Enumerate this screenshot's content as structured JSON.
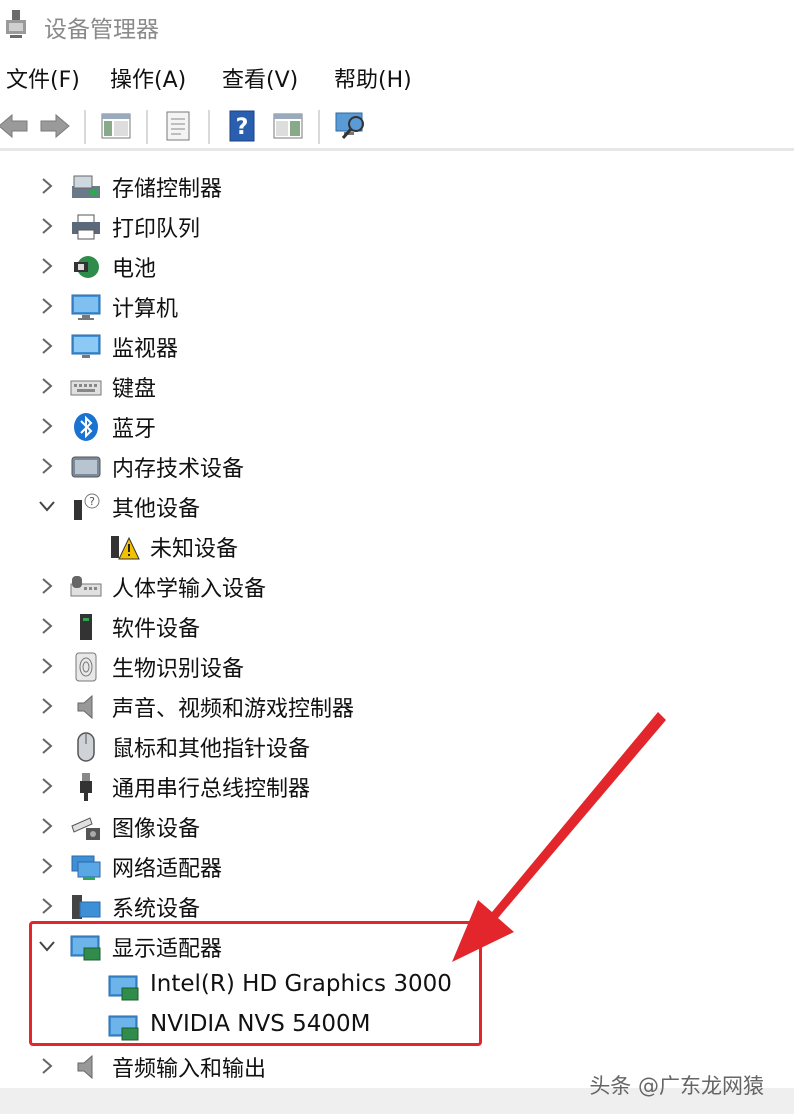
{
  "window": {
    "title": "设备管理器"
  },
  "menu": [
    "文件(F)",
    "操作(A)",
    "查看(V)",
    "帮助(H)"
  ],
  "toolbar": [
    "back-icon",
    "forward-icon",
    "show-hide-console-tree-icon",
    "properties-icon",
    "help-icon",
    "action-pane-icon",
    "scan-hardware-icon"
  ],
  "tree": [
    {
      "label": "存储控制器",
      "icon": "storage-controller-icon",
      "expanded": false
    },
    {
      "label": "打印队列",
      "icon": "printer-icon",
      "expanded": false
    },
    {
      "label": "电池",
      "icon": "battery-icon",
      "expanded": false
    },
    {
      "label": "计算机",
      "icon": "computer-icon",
      "expanded": false
    },
    {
      "label": "监视器",
      "icon": "monitor-icon",
      "expanded": false
    },
    {
      "label": "键盘",
      "icon": "keyboard-icon",
      "expanded": false
    },
    {
      "label": "蓝牙",
      "icon": "bluetooth-icon",
      "expanded": false
    },
    {
      "label": "内存技术设备",
      "icon": "memory-device-icon",
      "expanded": false
    },
    {
      "label": "其他设备",
      "icon": "other-devices-icon",
      "expanded": true
    },
    {
      "label": "未知设备",
      "icon": "unknown-device-warning-icon",
      "child": true
    },
    {
      "label": "人体学输入设备",
      "icon": "hid-icon",
      "expanded": false
    },
    {
      "label": "软件设备",
      "icon": "software-device-icon",
      "expanded": false
    },
    {
      "label": "生物识别设备",
      "icon": "biometric-icon",
      "expanded": false
    },
    {
      "label": "声音、视频和游戏控制器",
      "icon": "speaker-icon",
      "expanded": false
    },
    {
      "label": "鼠标和其他指针设备",
      "icon": "mouse-icon",
      "expanded": false
    },
    {
      "label": "通用串行总线控制器",
      "icon": "usb-icon",
      "expanded": false
    },
    {
      "label": "图像设备",
      "icon": "camera-icon",
      "expanded": false
    },
    {
      "label": "网络适配器",
      "icon": "network-adapter-icon",
      "expanded": false
    },
    {
      "label": "系统设备",
      "icon": "system-device-icon",
      "expanded": false
    },
    {
      "label": "显示适配器",
      "icon": "display-adapter-icon",
      "expanded": true
    },
    {
      "label": "Intel(R) HD Graphics 3000",
      "icon": "display-adapter-icon",
      "child": true
    },
    {
      "label": "NVIDIA NVS 5400M",
      "icon": "display-adapter-icon",
      "child": true
    },
    {
      "label": "音频输入和输出",
      "icon": "speaker-icon",
      "expanded": false
    }
  ],
  "watermark": "头条 @广东龙网猿",
  "colors": {
    "highlight": "#e3262b",
    "accent": "#1a73d1"
  }
}
